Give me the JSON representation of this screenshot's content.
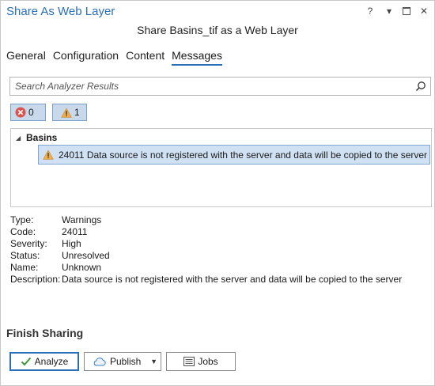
{
  "pane": {
    "title": "Share As Web Layer",
    "subtitle": "Share Basins_tif as a Web Layer",
    "controls": {
      "help": "?",
      "menu": "▾",
      "close": "✕"
    }
  },
  "tabs": [
    {
      "label": "General",
      "active": false
    },
    {
      "label": "Configuration",
      "active": false
    },
    {
      "label": "Content",
      "active": false
    },
    {
      "label": "Messages",
      "active": true
    }
  ],
  "search": {
    "placeholder": "Search Analyzer Results"
  },
  "filters": {
    "errors_count": "0",
    "warnings_count": "1"
  },
  "results": {
    "group": "Basins",
    "items": [
      {
        "text": "24011 Data source is not registered with the server and data will be copied to the server",
        "icon": "warning-icon",
        "selected": true
      }
    ]
  },
  "details": {
    "rows": [
      {
        "label": "Type:",
        "value": "Warnings"
      },
      {
        "label": "Code:",
        "value": "24011"
      },
      {
        "label": "Severity:",
        "value": "High"
      },
      {
        "label": "Status:",
        "value": "Unresolved"
      },
      {
        "label": "Name:",
        "value": "Unknown"
      },
      {
        "label": "Description:",
        "value": "Data source is not registered with the server and data will be copied to the server"
      }
    ]
  },
  "finish": {
    "title": "Finish Sharing",
    "analyze_label": "Analyze",
    "publish_label": "Publish",
    "jobs_label": "Jobs"
  },
  "colors": {
    "accent": "#2a6ebb",
    "selection": "#cfe1f3",
    "error": "#d9534f",
    "warning": "#f0ad4e"
  }
}
